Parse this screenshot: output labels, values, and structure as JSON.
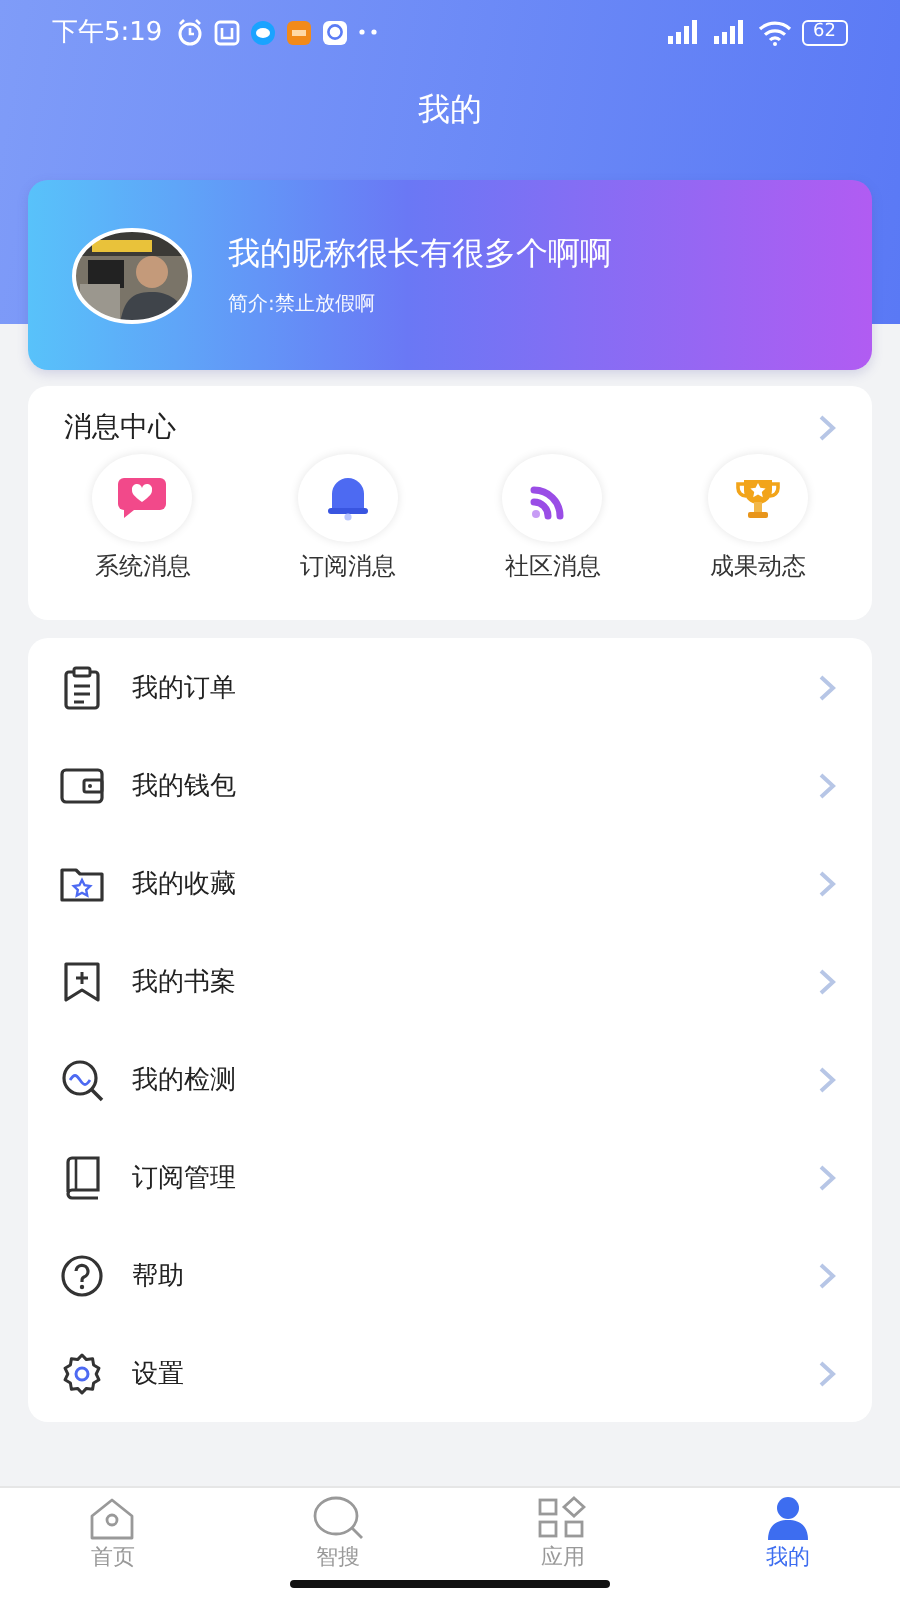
{
  "status_bar": {
    "time": "下午5:19",
    "battery": "62"
  },
  "title": "我的",
  "profile": {
    "nickname": "我的昵称很长有很多个啊啊",
    "bio": "简介:禁止放假啊"
  },
  "messages": {
    "title": "消息中心",
    "items": [
      {
        "label": "系统消息",
        "kind": "mail"
      },
      {
        "label": "订阅消息",
        "kind": "bell"
      },
      {
        "label": "社区消息",
        "kind": "feed"
      },
      {
        "label": "成果动态",
        "kind": "trophy"
      }
    ]
  },
  "menu": [
    {
      "label": "我的订单",
      "kind": "order"
    },
    {
      "label": "我的钱包",
      "kind": "wallet"
    },
    {
      "label": "我的收藏",
      "kind": "favorite"
    },
    {
      "label": "我的书案",
      "kind": "bookmark"
    },
    {
      "label": "我的检测",
      "kind": "detect"
    },
    {
      "label": "订阅管理",
      "kind": "book"
    },
    {
      "label": "帮助",
      "kind": "help"
    },
    {
      "label": "设置",
      "kind": "settings"
    }
  ],
  "tabs": [
    {
      "label": "首页",
      "kind": "home",
      "selected": false
    },
    {
      "label": "智搜",
      "kind": "search",
      "selected": false
    },
    {
      "label": "应用",
      "kind": "apps",
      "selected": false
    },
    {
      "label": "我的",
      "kind": "user",
      "selected": true
    }
  ]
}
